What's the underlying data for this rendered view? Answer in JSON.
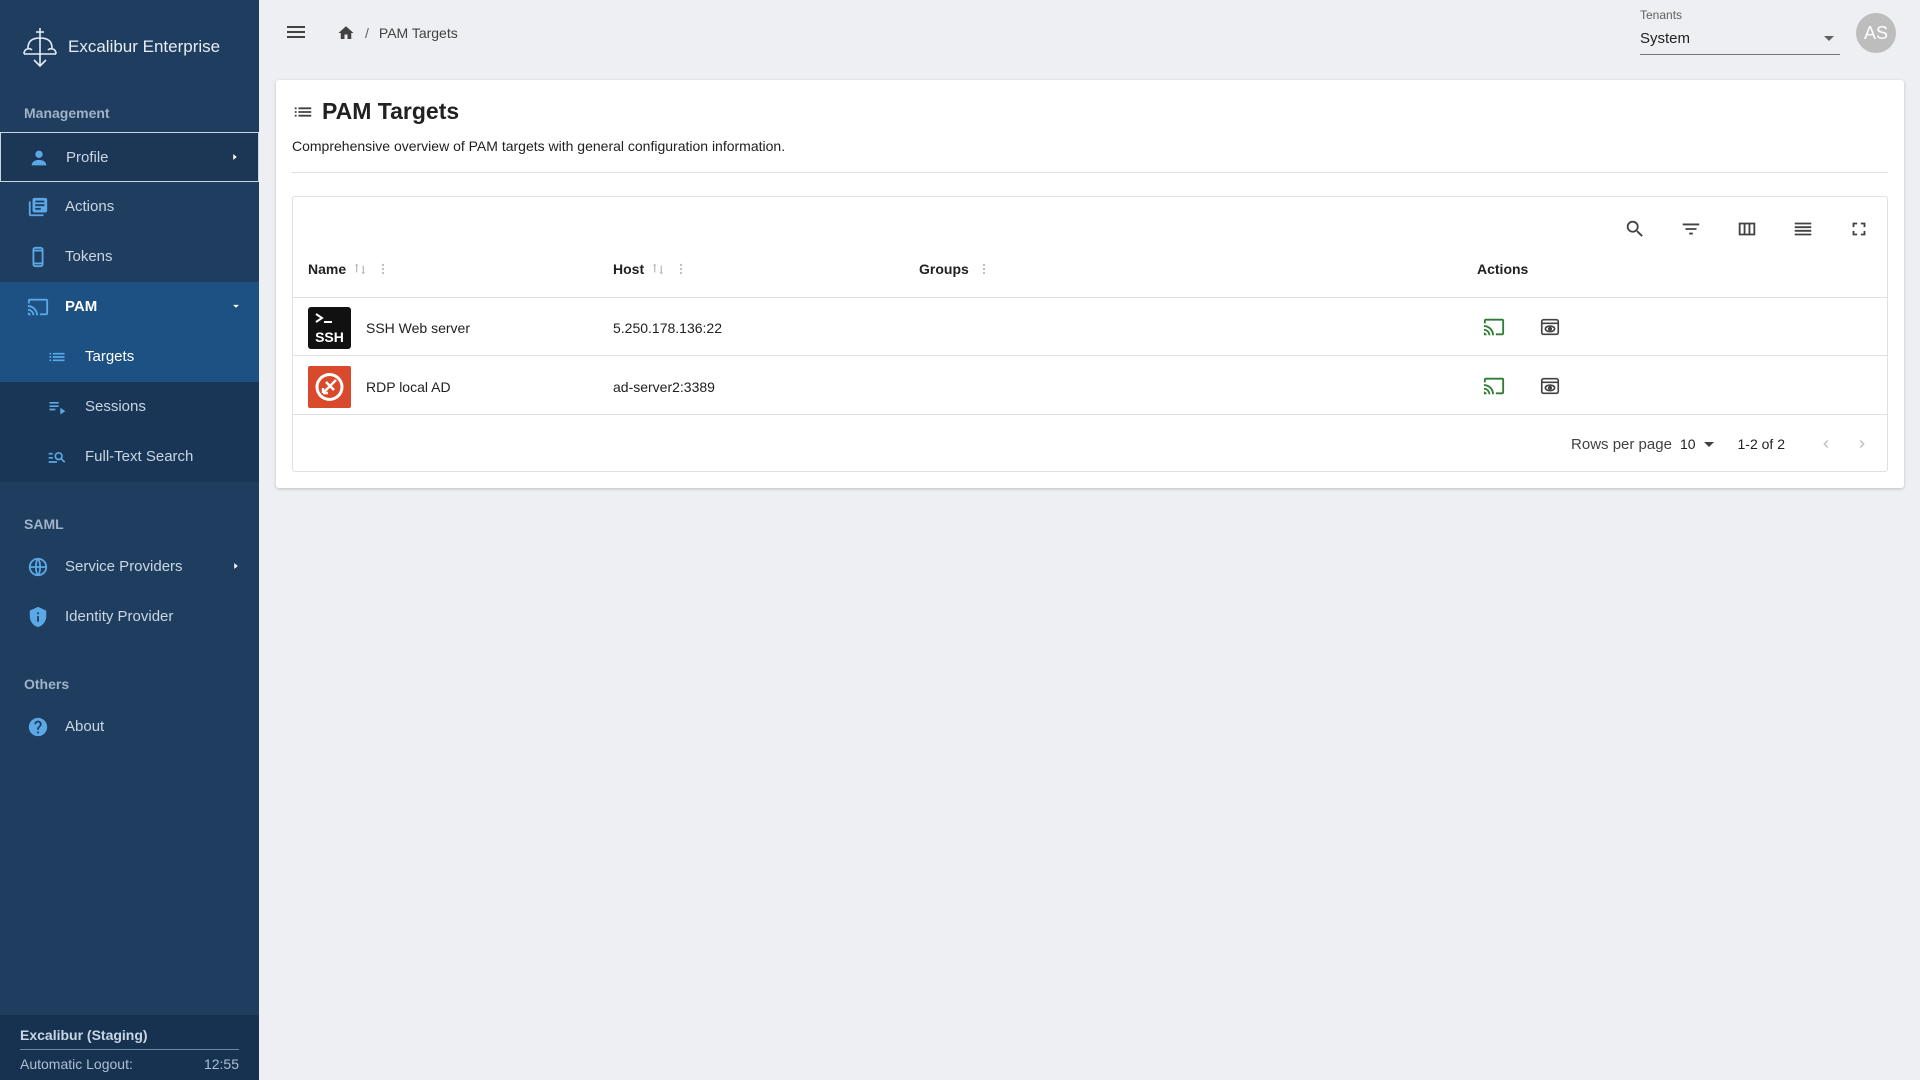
{
  "brand": {
    "title": "Excalibur Enterprise"
  },
  "sidebar": {
    "sections": {
      "management": "Management",
      "saml": "SAML",
      "others": "Others"
    },
    "items": {
      "profile": "Profile",
      "actions": "Actions",
      "tokens": "Tokens",
      "pam": "PAM",
      "targets": "Targets",
      "sessions": "Sessions",
      "fulltext": "Full-Text Search",
      "service_providers": "Service Providers",
      "identity_provider": "Identity Provider",
      "about": "About"
    },
    "footer": {
      "env": "Excalibur (Staging)",
      "logout_label": "Automatic Logout:",
      "timer": "12:55"
    }
  },
  "topbar": {
    "breadcrumb_current": "PAM Targets",
    "breadcrumb_sep": "/",
    "tenant_label": "Tenants",
    "tenant_value": "System",
    "avatar": "AS"
  },
  "page": {
    "title": "PAM Targets",
    "description": "Comprehensive overview of PAM targets with general configuration information."
  },
  "table": {
    "columns": {
      "name": "Name",
      "host": "Host",
      "groups": "Groups",
      "actions": "Actions"
    },
    "rows": [
      {
        "name": "SSH Web server",
        "host": "5.250.178.136:22",
        "logo_text": "SSH"
      },
      {
        "name": "RDP local AD",
        "host": "ad-server2:3389"
      }
    ],
    "pagination": {
      "rows_per_page_label": "Rows per page",
      "rows_per_page": "10",
      "range": "1-2 of 2"
    }
  },
  "colors": {
    "sidebar": "#1f3d5e",
    "active": "#1d5184",
    "connect_green": "#2e7d32",
    "rdp_red": "#d84a2b"
  }
}
